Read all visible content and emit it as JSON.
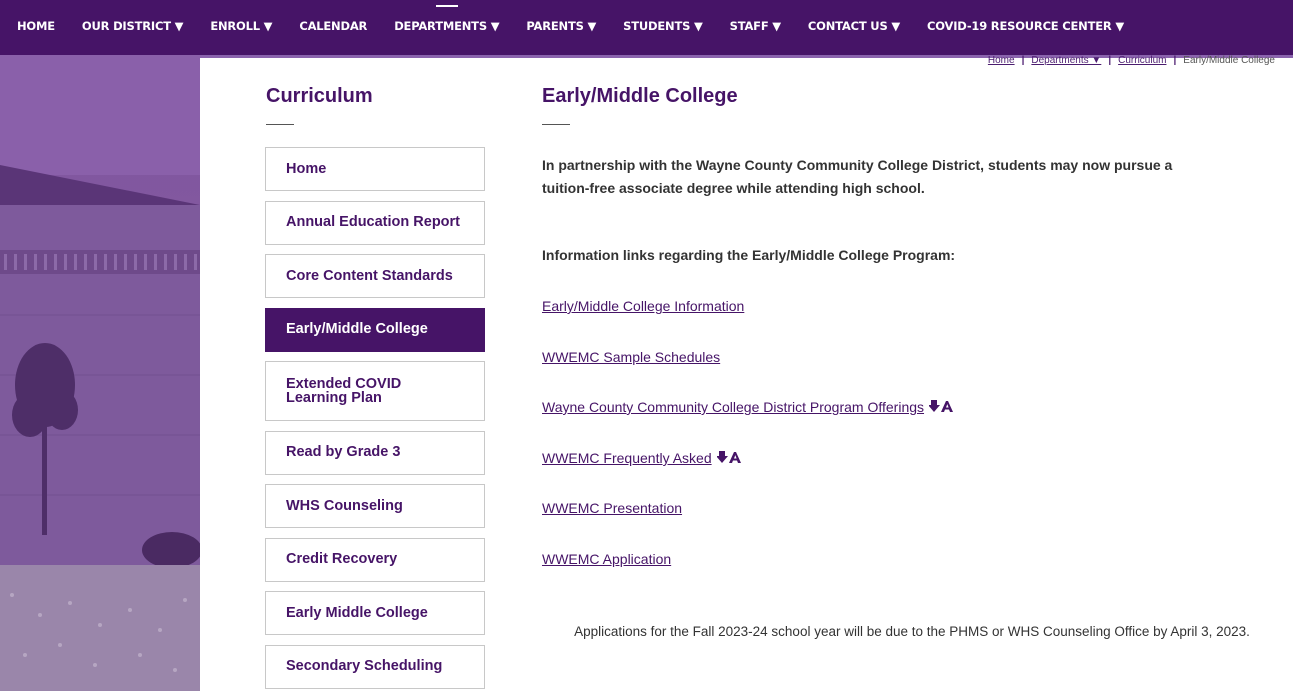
{
  "topnav": {
    "items": [
      {
        "label": "HOME"
      },
      {
        "label": "OUR DISTRICT ▼"
      },
      {
        "label": "ENROLL ▼"
      },
      {
        "label": "CALENDAR"
      },
      {
        "label": "DEPARTMENTS ▼"
      },
      {
        "label": "PARENTS ▼"
      },
      {
        "label": "STUDENTS ▼"
      },
      {
        "label": "STAFF ▼"
      },
      {
        "label": "CONTACT US ▼"
      },
      {
        "label": "COVID-19 RESOURCE CENTER ▼"
      }
    ],
    "active_index": 4
  },
  "breadcrumb": {
    "home": "Home",
    "departments": "Departments ▼",
    "curriculum": "Curriculum",
    "current": "Early/Middle College"
  },
  "sidebar": {
    "title": "Curriculum",
    "items": [
      {
        "label": "Home"
      },
      {
        "label": "Annual Education Report"
      },
      {
        "label": "Core Content Standards"
      },
      {
        "label": "Early/Middle College"
      },
      {
        "label": "Extended COVID Learning Plan"
      },
      {
        "label": "Read by Grade 3"
      },
      {
        "label": "WHS Counseling"
      },
      {
        "label": "Credit Recovery"
      },
      {
        "label": "Early Middle College"
      },
      {
        "label": "Secondary Scheduling"
      }
    ],
    "active_index": 3
  },
  "main": {
    "title": "Early/Middle College",
    "intro": "In partnership with the Wayne County Community College District, students may now pursue a tuition-free associate degree while attending high school.",
    "info_heading": "Information links regarding the Early/Middle College Program:",
    "links": [
      {
        "label": "Early/Middle College Information"
      },
      {
        "label": "WWEMC Sample Schedules"
      },
      {
        "label": "Wayne County Community College District Program Offerings"
      },
      {
        "label": "WWEMC Frequently Asked"
      },
      {
        "label": "WWEMC Presentation"
      },
      {
        "label": "WWEMC Application"
      }
    ],
    "notice": "Applications for the Fall 2023-24 school year will be due to the PHMS or WHS Counseling Office by April 3, 2023."
  },
  "colors": {
    "brand_purple": "#461467",
    "nav_stripe": "#8a63ad"
  },
  "icons": {
    "pdf_download": "pdf-download-icon"
  }
}
